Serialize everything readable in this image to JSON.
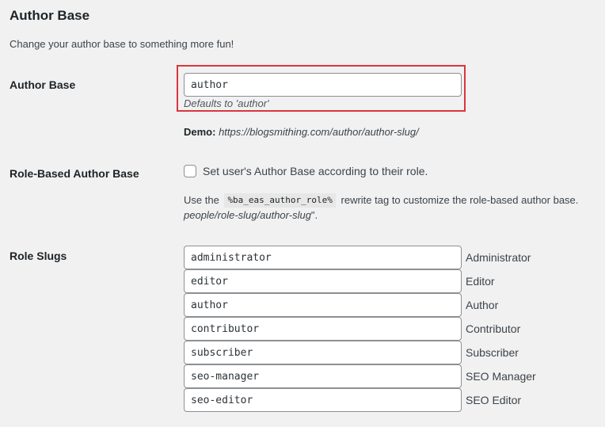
{
  "section": {
    "title": "Author Base",
    "description": "Change your author base to something more fun!"
  },
  "author_base": {
    "label": "Author Base",
    "input_value": "author",
    "hint": "Defaults to 'author'",
    "demo_label": "Demo:",
    "demo_url": "https://blogsmithing.com/author/author-slug/"
  },
  "role_based": {
    "label": "Role-Based Author Base",
    "checkbox_label": "Set user's Author Base according to their role.",
    "checked": false,
    "help_prefix": "Use the",
    "help_code": "%ba_eas_author_role%",
    "help_suffix": "rewrite tag to customize the role-based author base.",
    "help_line2_italic": "people/role-slug/author-slug",
    "help_line2_suffix": "\"."
  },
  "role_slugs": {
    "label": "Role Slugs",
    "items": [
      {
        "slug": "administrator",
        "role": "Administrator"
      },
      {
        "slug": "editor",
        "role": "Editor"
      },
      {
        "slug": "author",
        "role": "Author"
      },
      {
        "slug": "contributor",
        "role": "Contributor"
      },
      {
        "slug": "subscriber",
        "role": "Subscriber"
      },
      {
        "slug": "seo-manager",
        "role": "SEO Manager"
      },
      {
        "slug": "seo-editor",
        "role": "SEO Editor"
      }
    ]
  },
  "colors": {
    "highlight_border": "#d9363e",
    "background": "#f1f1f1",
    "input_border": "#8c8f94"
  }
}
